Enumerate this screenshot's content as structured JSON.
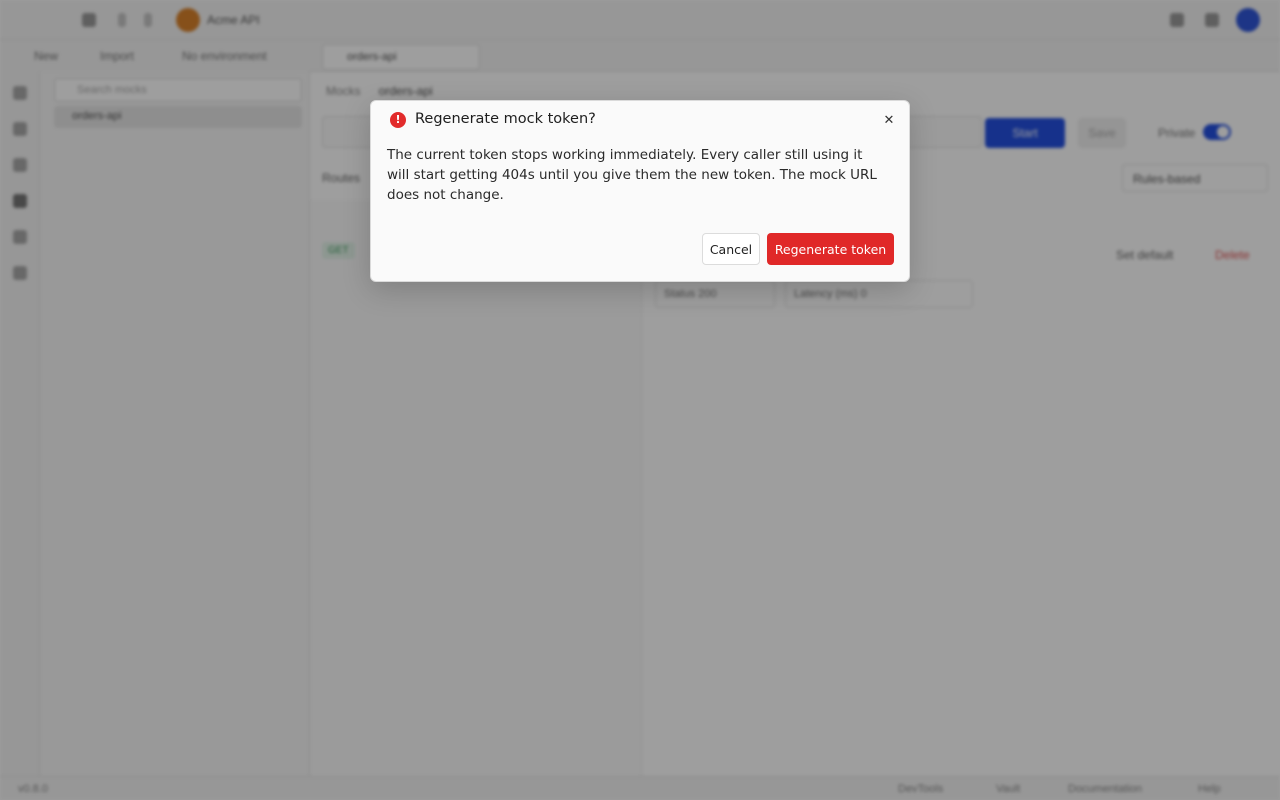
{
  "workspace": {
    "name": "Acme API"
  },
  "toolbar": {
    "new_label": "New",
    "import_label": "Import",
    "environment_label": "No environment"
  },
  "sidebar": {
    "search_placeholder": "Search mocks",
    "items": [
      {
        "label": "orders-api"
      }
    ]
  },
  "tabs": [
    {
      "label": "orders-api"
    }
  ],
  "breadcrumb": {
    "section": "Mocks",
    "current": "orders-api"
  },
  "mock": {
    "start_label": "Start",
    "save_label": "Save",
    "private_label": "Private",
    "private_enabled": true,
    "routes_label": "Routes",
    "rules_label": "Rules-based",
    "route_method": "GET",
    "set_default_label": "Set default",
    "delete_label": "Delete",
    "status_label": "Status",
    "status_value": "200",
    "latency_label": "Latency (ms)",
    "latency_value": "0"
  },
  "statusbar": {
    "version": "v0.8.0",
    "devtools": "DevTools",
    "vault": "Vault",
    "docs": "Documentation",
    "help": "Help"
  },
  "dialog": {
    "title": "Regenerate mock token?",
    "icon": "alert-circle-icon",
    "body": "The current token stops working immediately. Every caller still using it will start getting 404s until you give them the new token. The mock URL does not change.",
    "cancel_label": "Cancel",
    "confirm_label": "Regenerate token",
    "close_icon": "close-icon",
    "colors": {
      "danger": "#e02828",
      "overlay": "rgba(0,0,0,0.38)"
    }
  }
}
